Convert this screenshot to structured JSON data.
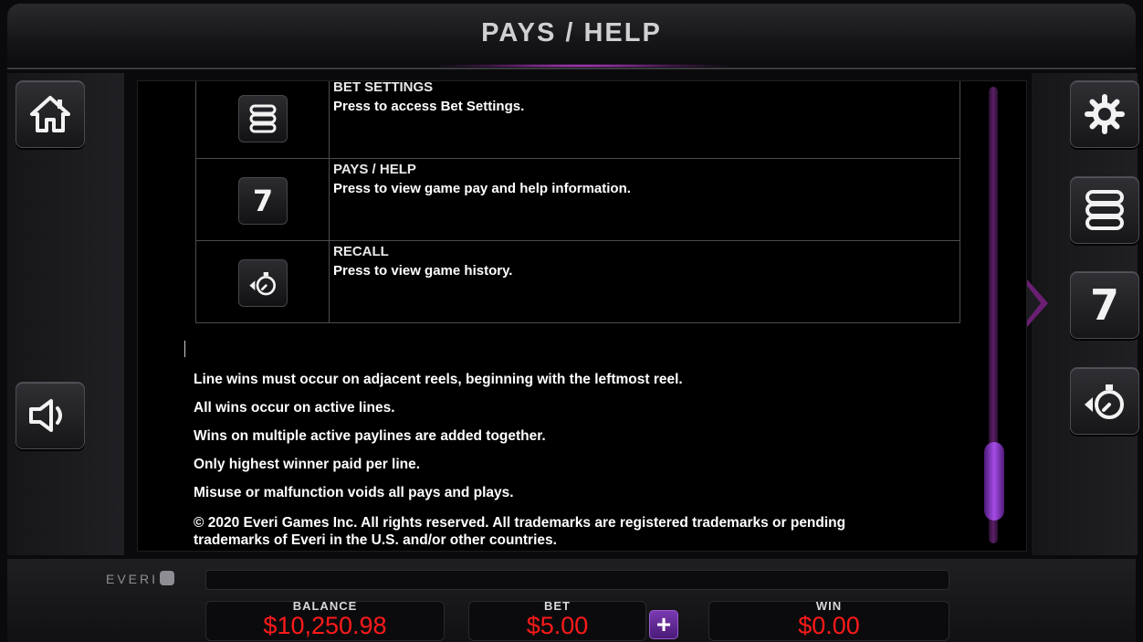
{
  "header": {
    "title": "PAYS / HELP"
  },
  "left_buttons": {
    "home_icon": "home-icon",
    "sound_icon": "speaker-icon",
    "menu_icon": "hamburger-icon"
  },
  "right_buttons": {
    "settings_icon": "gear-icon",
    "bet_icon": "coin-stack-icon",
    "pays_icon": "seven-icon",
    "recall_icon": "recall-timer-icon",
    "seven_glyph": "7"
  },
  "help_table": {
    "rows": [
      {
        "title": "BET SETTINGS",
        "desc": "Press to access Bet Settings.",
        "icon": "coin-stack-icon"
      },
      {
        "title": "PAYS / HELP",
        "desc": "Press to view game pay and help information.",
        "icon": "seven-icon"
      },
      {
        "title": "RECALL",
        "desc": "Press to view game history.",
        "icon": "recall-timer-icon"
      }
    ]
  },
  "rules": [
    "Line wins must occur on adjacent reels, beginning with the leftmost reel.",
    "All wins occur on active lines.",
    "Wins on multiple active paylines are added together.",
    "Only highest winner paid per line.",
    "Misuse or malfunction voids all pays and plays."
  ],
  "copyright": {
    "line1": "© 2020 Everi Games Inc. All rights reserved. All trademarks are registered trademarks or pending",
    "line2": "trademarks of Everi in the U.S. and/or other countries."
  },
  "footer": {
    "brand": "EVERI",
    "balance_label": "BALANCE",
    "balance_value": "$10,250.98",
    "bet_label": "BET",
    "bet_value": "$5.00",
    "bet_plus": "+",
    "win_label": "WIN",
    "win_value": "$0.00"
  },
  "colors": {
    "accent": "#a64de8",
    "meter_value": "#ff1a1a",
    "background": "#0a0a0c"
  }
}
